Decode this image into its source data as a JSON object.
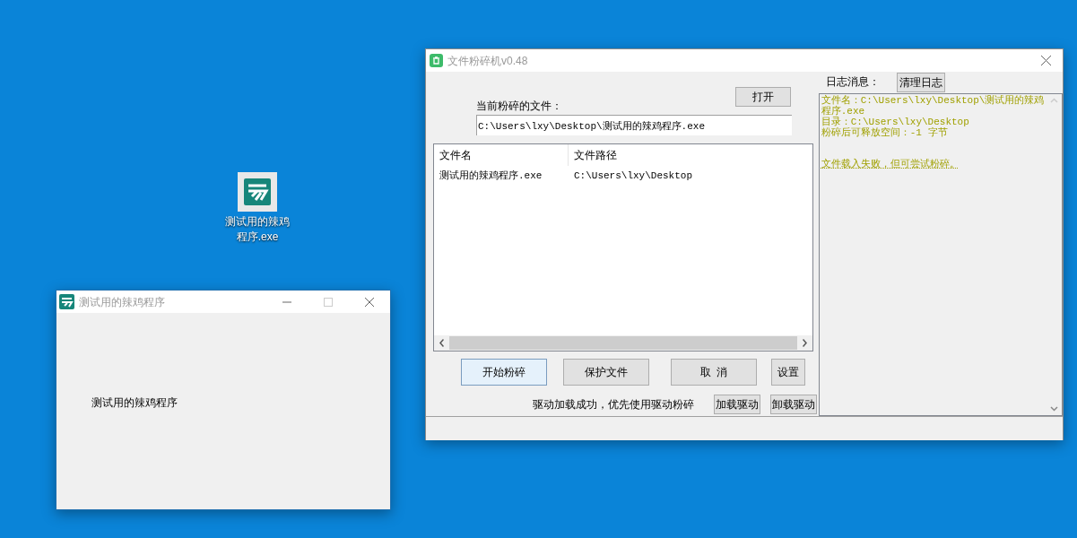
{
  "desktop_icons": [
    {
      "label": "测试用的辣鸡程序.exe"
    }
  ],
  "app_window": {
    "title": "测试用的辣鸡程序",
    "text": "测试用的辣鸡程序"
  },
  "shredder_window": {
    "title": "文件粉碎机v0.48",
    "open_button": "打开",
    "current_file_label": "当前粉碎的文件：",
    "current_file": "C:\\Users\\lxy\\Desktop\\测试用的辣鸡程序.exe",
    "table": {
      "columns": [
        "文件名",
        "文件路径"
      ],
      "rows": [
        [
          "测试用的辣鸡程序.exe",
          "C:\\Users\\lxy\\Desktop"
        ]
      ]
    },
    "buttons": [
      {
        "label": "开始粉碎",
        "focused": true
      },
      {
        "label": "保护文件",
        "focused": false
      },
      {
        "label": "取  消",
        "focused": false
      },
      {
        "label": "设置",
        "focused": false
      }
    ],
    "driver_status": "驱动加载成功，优先使用驱动粉碎",
    "driver_buttons": [
      "加载驱动",
      "卸载驱动"
    ],
    "log_label": "日志消息：",
    "clear_log_button": "清理日志",
    "log_lines": [
      {
        "text": "文件名：C:\\Users\\lxy\\Desktop\\测试用的辣鸡程序.exe",
        "kind": "info"
      },
      {
        "text": "目录：C:\\Users\\lxy\\Desktop",
        "kind": "info"
      },
      {
        "text": "粉碎后可释放空间：-1 字节",
        "kind": "info"
      },
      {
        "text": "文件载入失败，但可尝试粉碎。",
        "kind": "warning"
      }
    ]
  }
}
